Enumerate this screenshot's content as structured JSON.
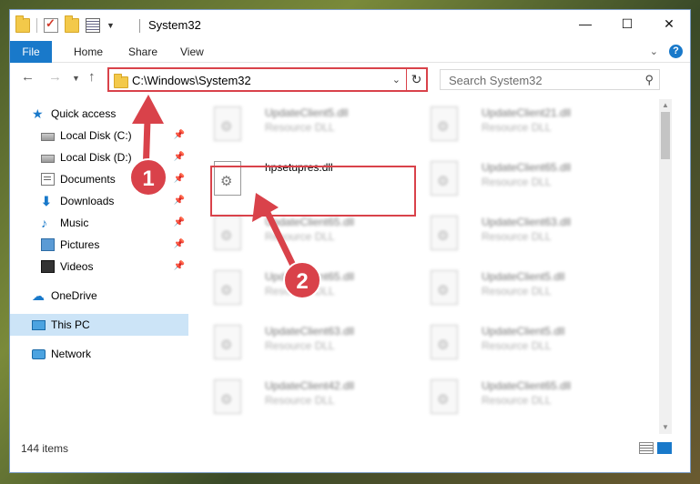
{
  "window": {
    "title": "System32",
    "controls": {
      "minimize": "—",
      "maximize": "☐",
      "close": "✕"
    }
  },
  "ribbon": {
    "tabs": [
      "File",
      "Home",
      "Share",
      "View"
    ]
  },
  "nav": {
    "address": "C:\\Windows\\System32",
    "search_placeholder": "Search System32"
  },
  "sidebar": {
    "items": [
      {
        "label": "Quick access",
        "icon": "star-icon",
        "pinned": false
      },
      {
        "label": "Local Disk (C:)",
        "icon": "drive-icon",
        "pinned": true
      },
      {
        "label": "Local Disk (D:)",
        "icon": "drive-icon",
        "pinned": true
      },
      {
        "label": "Documents",
        "icon": "documents-icon",
        "pinned": true
      },
      {
        "label": "Downloads",
        "icon": "downloads-icon",
        "pinned": true
      },
      {
        "label": "Music",
        "icon": "music-icon",
        "pinned": true
      },
      {
        "label": "Pictures",
        "icon": "pictures-icon",
        "pinned": true
      },
      {
        "label": "Videos",
        "icon": "videos-icon",
        "pinned": true
      },
      {
        "label": "OneDrive",
        "icon": "onedrive-icon",
        "pinned": false
      },
      {
        "label": "This PC",
        "icon": "pc-icon",
        "pinned": false,
        "selected": true
      },
      {
        "label": "Network",
        "icon": "network-icon",
        "pinned": false
      }
    ]
  },
  "files": {
    "col1": [
      {
        "name": "UpdateClient5.dll",
        "type": "Resource DLL"
      },
      {
        "name": "hpsetupres.dll",
        "type": "",
        "highlighted": true
      },
      {
        "name": "UpdateClient65.dll",
        "type": "Resource DLL"
      },
      {
        "name": "UpdateClient65.dll",
        "type": "Resource DLL"
      },
      {
        "name": "UpdateClient63.dll",
        "type": "Resource DLL"
      },
      {
        "name": "UpdateClient42.dll",
        "type": "Resource DLL"
      }
    ],
    "col2": [
      {
        "name": "UpdateClient21.dll",
        "type": "Resource DLL"
      },
      {
        "name": "UpdateClient65.dll",
        "type": "Resource DLL"
      },
      {
        "name": "UpdateClient63.dll",
        "type": "Resource DLL"
      },
      {
        "name": "UpdateClient5.dll",
        "type": "Resource DLL"
      },
      {
        "name": "UpdateClient5.dll",
        "type": "Resource DLL"
      },
      {
        "name": "UpdateClient65.dll",
        "type": "Resource DLL"
      }
    ]
  },
  "status": {
    "item_count": "144 items"
  },
  "annotations": {
    "step1": "1",
    "step2": "2",
    "accent_color": "#d9424a"
  }
}
